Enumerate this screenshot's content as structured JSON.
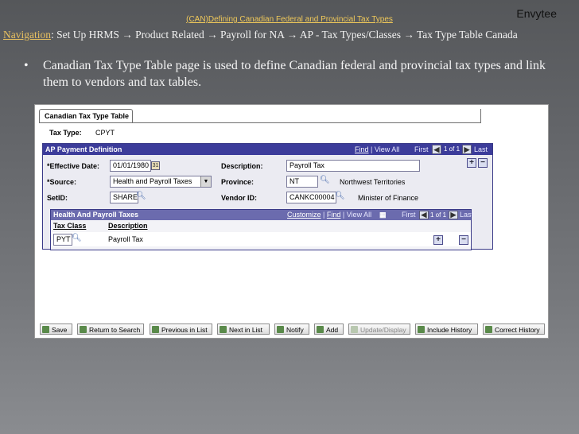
{
  "slide": {
    "title": "(CAN)Defining Canadian Federal and Provincial Tax Types",
    "brand": "Envytee",
    "navigation_label": "Navigation",
    "navigation_path": ": Set Up HRMS → Product Related → Payroll for NA → AP - Tax Types/Classes → Tax Type Table Canada",
    "bullet": "Canadian Tax Type Table page is used to define Canadian federal and provincial tax types and link them to vendors and tax tables."
  },
  "page": {
    "tab_label": "Canadian Tax Type Table",
    "tax_type_label": "Tax Type:",
    "tax_type_value": "CPYT",
    "panel": {
      "title": "AP Payment Definition",
      "find": "Find",
      "view_all": "View All",
      "first": "First",
      "count": "1 of 1",
      "last": "Last",
      "effective_date_label": "*Effective Date:",
      "effective_date_value": "01/01/1980",
      "source_label": "*Source:",
      "source_value": "Health and Payroll Taxes",
      "setid_label": "SetID:",
      "setid_value": "SHARE",
      "description_label": "Description:",
      "description_value": "Payroll Tax",
      "province_label": "Province:",
      "province_value": "NT",
      "province_desc": "Northwest Territories",
      "vendor_label": "Vendor ID:",
      "vendor_value": "CANKC00004",
      "vendor_desc": "Minister of Finance"
    },
    "subpanel": {
      "title": "Health And Payroll Taxes",
      "customize": "Customize",
      "find": "Find",
      "view_all": "View All",
      "first": "First",
      "count": "1 of 1",
      "last": "Last",
      "col_tax_class": "Tax Class",
      "col_description": "Description",
      "row_tax_class": "PYT",
      "row_description": "Payroll Tax"
    },
    "toolbar": {
      "save": "Save",
      "return_to_search": "Return to Search",
      "previous_in_list": "Previous in List",
      "next_in_list": "Next in List",
      "notify": "Notify",
      "add": "Add",
      "update_display": "Update/Display",
      "include_history": "Include History",
      "correct_history": "Correct History"
    }
  }
}
